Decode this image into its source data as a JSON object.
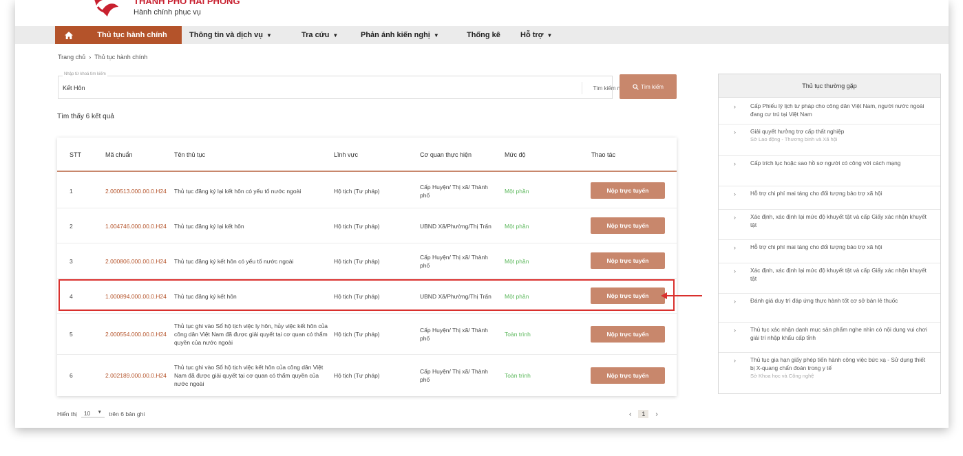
{
  "header": {
    "brand_name": "THÀNH PHỐ HẢI PHÒNG",
    "brand_sub": "Hành chính phục vụ"
  },
  "nav": {
    "home_icon": "home-icon",
    "items": [
      {
        "label": "Thủ tục hành chính",
        "dropdown": false
      },
      {
        "label": "Thông tin và dịch vụ",
        "dropdown": true
      },
      {
        "label": "Tra cứu",
        "dropdown": true
      },
      {
        "label": "Phản ánh kiến nghị",
        "dropdown": true
      },
      {
        "label": "Thống kê",
        "dropdown": false
      },
      {
        "label": "Hỗ trợ",
        "dropdown": true
      }
    ]
  },
  "breadcrumb": {
    "home": "Trang chủ",
    "separator": "›",
    "current": "Thủ tục hành chính"
  },
  "search": {
    "floating_label": "Nhập từ khoá tìm kiếm",
    "value": "Kết Hôn",
    "advanced_label": "Tìm kiếm nâng cao",
    "button_label": "Tìm kiếm"
  },
  "results": {
    "count_text": "Tìm thấy 6 kết quả",
    "columns": [
      "STT",
      "Mã chuẩn",
      "Tên thủ tục",
      "Lĩnh vực",
      "Cơ quan thực hiện",
      "Mức độ",
      "Thao tác"
    ],
    "rows": [
      {
        "stt": "1",
        "code": "2.000513.000.00.0.H24",
        "name": "Thủ tục đăng ký lại kết hôn có yếu tố nước ngoài",
        "field": "Hộ tịch (Tư pháp)",
        "agency": "Cấp Huyện/ Thị xã/ Thành phố",
        "level": "Một phần",
        "action": "Nộp trực tuyến"
      },
      {
        "stt": "2",
        "code": "1.004746.000.00.0.H24",
        "name": "Thủ tục đăng ký lại kết hôn",
        "field": "Hộ tịch (Tư pháp)",
        "agency": "UBND Xã/Phường/Thị Trấn",
        "level": "Một phần",
        "action": "Nộp trực tuyến"
      },
      {
        "stt": "3",
        "code": "2.000806.000.00.0.H24",
        "name": "Thủ tục đăng ký kết hôn có yếu tố nước ngoài",
        "field": "Hộ tịch (Tư pháp)",
        "agency": "Cấp Huyện/ Thị xã/ Thành phố",
        "level": "Một phần",
        "action": "Nộp trực tuyến"
      },
      {
        "stt": "4",
        "code": "1.000894.000.00.0.H24",
        "name": "Thủ tục đăng ký kết hôn",
        "field": "Hộ tịch (Tư pháp)",
        "agency": "UBND Xã/Phường/Thị Trấn",
        "level": "Một phần",
        "action": "Nộp trực tuyến"
      },
      {
        "stt": "5",
        "code": "2.000554.000.00.0.H24",
        "name": "Thủ tục ghi vào Sổ hộ tịch việc ly hôn, hủy việc kết hôn của công dân Việt Nam đã được giải quyết tại cơ quan có thẩm quyền của nước ngoài",
        "field": "Hộ tịch (Tư pháp)",
        "agency": "Cấp Huyện/ Thị xã/ Thành phố",
        "level": "Toàn trình",
        "action": "Nộp trực tuyến"
      },
      {
        "stt": "6",
        "code": "2.002189.000.00.0.H24",
        "name": "Thủ tục ghi vào Sổ hộ tịch việc kết hôn của công dân Việt Nam đã được giải quyết tại cơ quan có thẩm quyền của nước ngoài",
        "field": "Hộ tịch (Tư pháp)",
        "agency": "Cấp Huyện/ Thị xã/ Thành phố",
        "level": "Toàn trình",
        "action": "Nộp trực tuyến"
      }
    ]
  },
  "pagination": {
    "show_label": "Hiển thị",
    "page_size": "10",
    "total_text": "trên 6 bản ghi",
    "prev": "‹",
    "current_page": "1",
    "next": "›"
  },
  "sidebar": {
    "title": "Thủ tục thường gặp",
    "items": [
      {
        "text": "Cấp Phiếu lý lịch tư pháp cho công dân Việt Nam, người nước ngoài đang cư trú tại Việt Nam",
        "agency": ""
      },
      {
        "text": "Giải quyết hưởng trợ cấp thất nghiệp",
        "agency": "Sở Lao động - Thương binh và Xã hội"
      },
      {
        "text": "Cấp trích lục hoặc sao hồ sơ người có công với cách mạng",
        "agency": ""
      },
      {
        "text": "Hỗ trợ chi phí mai táng cho đối tượng bảo trợ xã hội",
        "agency": ""
      },
      {
        "text": "Xác định, xác định lại mức độ khuyết tật và cấp Giấy xác nhận khuyết tật",
        "agency": ""
      },
      {
        "text": "Hỗ trợ chi phí mai táng cho đối tượng bảo trợ xã hội",
        "agency": ""
      },
      {
        "text": "Xác định, xác định lại mức độ khuyết tật và cấp Giấy xác nhận khuyết tật",
        "agency": ""
      },
      {
        "text": "Đánh giá duy trì đáp ứng thực hành tốt cơ sở bán lẻ thuốc",
        "agency": ""
      },
      {
        "text": "Thủ tục xác nhận danh mục sản phẩm nghe nhìn có nội dung vui chơi giải trí nhập khẩu cấp tỉnh",
        "agency": ""
      },
      {
        "text": "Thủ tục gia hạn giấy phép tiến hành công việc bức xạ - Sử dụng thiết bị X-quang chẩn đoán trong y tế",
        "agency": "Sở Khoa học và Công nghệ"
      }
    ]
  },
  "colors": {
    "brand_red": "#c8202f",
    "accent_brown": "#b4532a",
    "button_tan": "#c8876c",
    "highlight_red": "#d9302d",
    "level_green": "#5cb85c"
  }
}
